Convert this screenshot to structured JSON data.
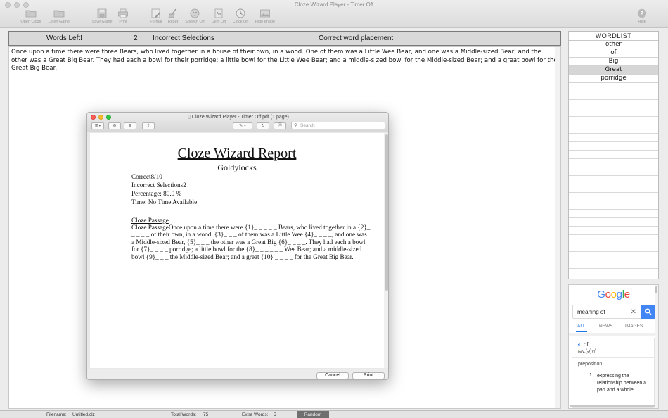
{
  "window": {
    "title": "Cloze Wizard Player - Timer Off"
  },
  "toolbar": {
    "open_cloze": "Open Cloze",
    "open_game": "Open Game",
    "save_game": "Save Game",
    "print": "Print",
    "format": "Format",
    "reset": "Reset",
    "speech_off": "Speech Off",
    "defn_off": "Defn Off",
    "clock_off": "Clock Off",
    "hide_image": "Hide Image",
    "help": "Help"
  },
  "scorebar": {
    "words_left_label": "Words Left!",
    "count": "2",
    "incorrect_label": "Incorrect Selections",
    "message": "Correct word placement!"
  },
  "passage": {
    "text": "Once upon a time there were three Bears, who lived together in a house of their own, in a wood. One of them was a Little Wee Bear, and one was a Middle-sized Bear, and the other was a Great Big Bear. They had each a bowl for their porridge; a little bowl for the Little Wee Bear; and a middle-sized bowl for the Middle-sized Bear; and a great bowl for the Great Big Bear."
  },
  "wordlist": {
    "header": "WORDLIST",
    "items": [
      {
        "word": "other",
        "selected": false
      },
      {
        "word": "of",
        "selected": false
      },
      {
        "word": "Big",
        "selected": false
      },
      {
        "word": "Great",
        "selected": true
      },
      {
        "word": "porridge",
        "selected": false
      }
    ]
  },
  "google": {
    "logo": "Google",
    "query": "meaning of",
    "tabs": [
      "ALL",
      "NEWS",
      "IMAGES"
    ],
    "active_tab": "ALL",
    "word": "of",
    "phonetic": "/əv,(ə)v/",
    "part_of_speech": "preposition",
    "def_number": "1.",
    "definition": "expressing the relationship between a part and a whole.",
    "colors": {
      "blue": "#4285f4",
      "red": "#ea4335",
      "yellow": "#fbbc05",
      "green": "#34a853"
    }
  },
  "statusbar": {
    "filename_label": "Filename:",
    "filename": "Untitled.clz",
    "total_words_label": "Total Words:",
    "total_words": "75",
    "extra_words_label": "Extra Words:",
    "extra_words": "5",
    "random_label": "Random"
  },
  "pdf": {
    "window_title": "Cloze Wizard Player - Timer Off.pdf (1 page)",
    "search_placeholder": "Search",
    "report_title": "Cloze Wizard Report",
    "story_title": "Goldylocks",
    "correct": "Correct8/10",
    "incorrect": "Incorrect Selections2",
    "percentage": "Percentage: 80.0 %",
    "time": "Time: No Time Available",
    "cloze_heading": "Cloze Passage",
    "cloze_text": "Cloze PassageOnce upon a time there were {1}_ _ _ _ _ Bears, who lived together in a {2}_ _ _ _ _ of their own, in a wood. {3}_ _ _ of them was a Little Wee {4}_ _ _ _, and one was a Middle-sized Bear, {5}_ _ _ the other was a Great Big {6}_ _ _ _. They had each a bowl for {7}_ _ _ _ porridge; a little bowl for the {8}_ _ _ _ _ _ Wee Bear; and a middle-sized bowl {9}_ _ _ the Middle-sized Bear; and a great {10} _ _ _ _ for the Great Big Bear.",
    "cancel_label": "Cancel",
    "print_label": "Print"
  }
}
